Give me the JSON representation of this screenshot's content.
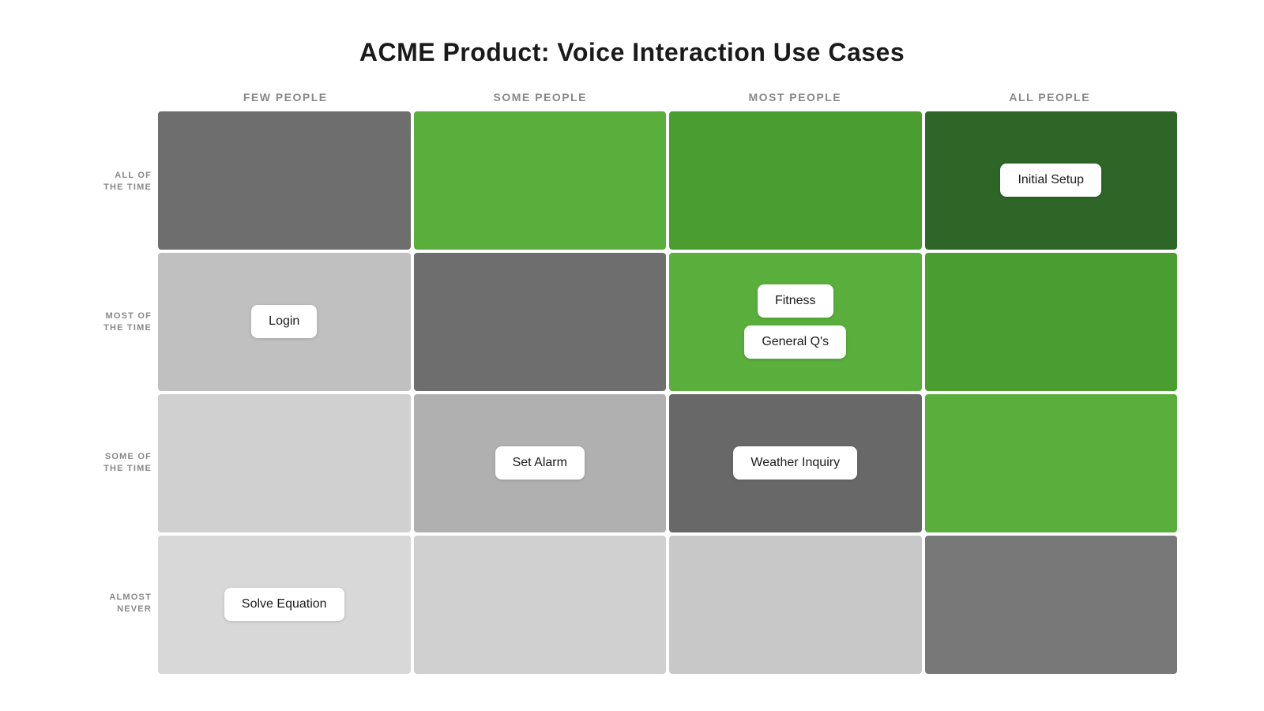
{
  "title": "ACME Product: Voice Interaction Use Cases",
  "col_headers": [
    "FEW PEOPLE",
    "SOME PEOPLE",
    "MOST PEOPLE",
    "ALL PEOPLE"
  ],
  "row_labels": [
    [
      "ALL OF",
      "THE TIME"
    ],
    [
      "MOST OF",
      "THE TIME"
    ],
    [
      "SOME OF",
      "THE TIME"
    ],
    [
      "ALMOST",
      "NEVER"
    ]
  ],
  "cells": {
    "r1c4_tag": "Initial Setup",
    "r2c1_tag": "Login",
    "r2c3_tag1": "Fitness",
    "r2c3_tag2": "General Q's",
    "r3c2_tag": "Set Alarm",
    "r3c3_tag": "Weather Inquiry",
    "r4c1_tag": "Solve Equation"
  }
}
